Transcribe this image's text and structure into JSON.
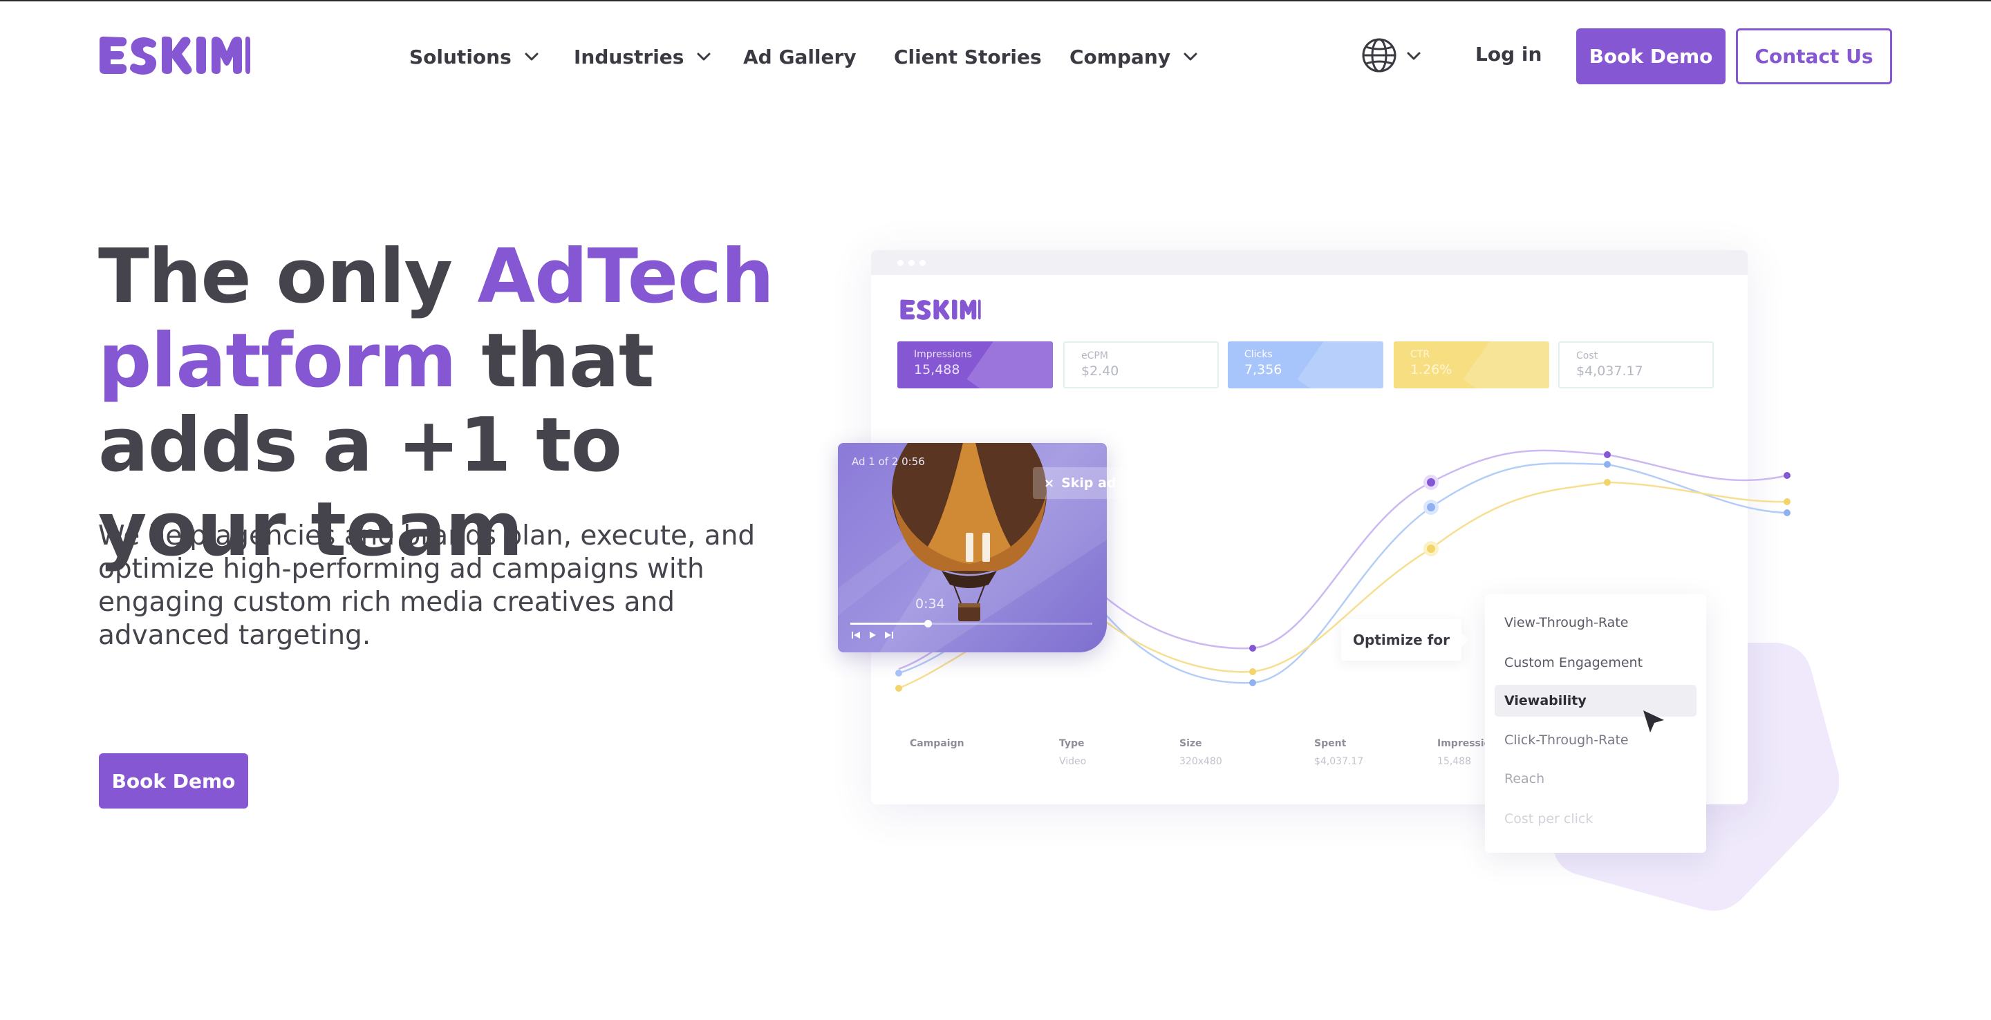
{
  "colors": {
    "brand": "#8557d3",
    "text_dark": "#45434b",
    "blue": "#a8c5fb",
    "yellow": "#f7de80"
  },
  "header": {
    "logo_text": "ESKIMI",
    "nav": [
      {
        "label": "Solutions",
        "has_dropdown": true
      },
      {
        "label": "Industries",
        "has_dropdown": true
      },
      {
        "label": "Ad Gallery",
        "has_dropdown": false
      },
      {
        "label": "Client Stories",
        "has_dropdown": false
      },
      {
        "label": "Company",
        "has_dropdown": true
      }
    ],
    "language_icon": "globe-icon",
    "login_label": "Log in",
    "book_demo_label": "Book Demo",
    "contact_label": "Contact Us"
  },
  "hero": {
    "headline_part1": "The only ",
    "headline_accent1": "AdTech",
    "headline_accent2": "platform",
    "headline_part2": " that adds a +1 to your team",
    "subtext": "We help agencies and brands plan, execute, and optimize high-performing ad campaigns with engaging custom rich media creatives and advanced targeting.",
    "cta_label": "Book Demo"
  },
  "dashboard": {
    "logo_text": "ESKIMI",
    "stats": [
      {
        "label": "Impressions",
        "value": "15,488"
      },
      {
        "label": "eCPM",
        "value": "$2.40"
      },
      {
        "label": "Clicks",
        "value": "7,356"
      },
      {
        "label": "CTR",
        "value": "1.26%"
      },
      {
        "label": "Cost",
        "value": "$4,037.17"
      }
    ],
    "table_headers": [
      "Campaign",
      "Type",
      "Size",
      "Spent",
      "Impressions"
    ],
    "table_row": [
      "",
      "Video",
      "320x480",
      "$4,037.17",
      "15,488"
    ],
    "video": {
      "ad_label": "Ad 1 of 2   0:56",
      "skip_label": "Skip ad",
      "time": "0:34",
      "progress": 0.32
    },
    "optimize_label": "Optimize for",
    "optimize_options": [
      "View-Through-Rate",
      "Custom Engagement",
      "Viewability",
      "Click-Through-Rate",
      "Reach",
      "Cost per click"
    ],
    "optimize_selected": "Viewability"
  }
}
